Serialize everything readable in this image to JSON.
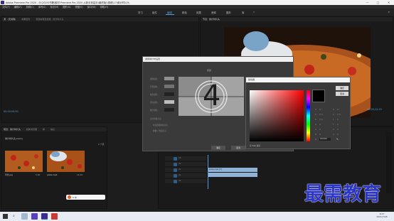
{
  "window": {
    "title": "Adobe Premiere Pro 2020 - D:\\2020\\书籍\\素材 Premiere Pro 2020 从新手到高手(最终版)\\视频\\17\\倒计时片头.",
    "minimize": "—",
    "maximize": "□",
    "close": "✕"
  },
  "menu": [
    "文件(F)",
    "编辑(E)",
    "剪辑(C)",
    "序列(S)",
    "标记(M)",
    "图形(G)",
    "视图(V)",
    "窗口(W)",
    "帮助(H)"
  ],
  "workspaces": {
    "tabs": [
      "学习",
      "组件",
      "编辑",
      "颜色",
      "效果",
      "音频",
      "图形",
      "库"
    ],
    "active_index": 2,
    "more": "»"
  },
  "source_panel": {
    "tabs": [
      "源：(无剪辑)",
      "效果控件",
      "音频剪辑混合器：倒计时片头"
    ],
    "timecode": "00;00;00;00"
  },
  "program_panel": {
    "tabs": [
      "节目：倒计时片头"
    ],
    "timecode_right": "00;00;12;19"
  },
  "project_panel": {
    "tabs": [
      "项目：倒计时片头",
      "媒体浏览器",
      "库",
      "信息"
    ],
    "file": "倒计时片头.prproj",
    "count": "2 个项",
    "items": [
      {
        "name": "背景.jpg",
        "dur": "5;00"
      },
      {
        "name": "pizza.mp4",
        "dur": "12;19"
      }
    ]
  },
  "timeline": {
    "tracks": [
      "V3",
      "V2",
      "V1",
      "A1",
      "A2"
    ],
    "clips": [
      {
        "label": "pizza.mp4 [V]"
      },
      {
        "label": ""
      }
    ]
  },
  "countdown_dialog": {
    "title": "通用倒计时设置",
    "section": "视频",
    "labels": [
      "擦除颜色：",
      "背景颜色：",
      "线条颜色：",
      "目标颜色：",
      "数字颜色："
    ],
    "swatch_colors": [
      "#8f8f8f",
      "#727272",
      "#222222",
      "#bdbdbd",
      "#222222"
    ],
    "options_label": "出点时提示音",
    "options": [
      "在每秒都响提示音",
      "倒数 2 秒提示音"
    ],
    "number": "4",
    "ok": "确定",
    "cancel": "取消"
  },
  "color_picker": {
    "title": "拾色器",
    "ok": "确定",
    "cancel": "取消",
    "web_only": "仅 Web 颜色",
    "fields": [
      {
        "label": "H",
        "value": "0 °"
      },
      {
        "label": "H",
        "value": "0 °"
      },
      {
        "label": "S",
        "value": "0 %"
      },
      {
        "label": "S",
        "value": "0 %"
      },
      {
        "label": "B",
        "value": "0 %"
      },
      {
        "label": "L",
        "value": "0"
      },
      {
        "label": "R",
        "value": "0"
      },
      {
        "label": "Y",
        "value": "0"
      },
      {
        "label": "G",
        "value": "0"
      },
      {
        "label": "U",
        "value": "0"
      },
      {
        "label": "B",
        "value": "0"
      },
      {
        "label": "V",
        "value": "0"
      }
    ],
    "hex": "000000"
  },
  "ime_bar": {
    "label": "S 中"
  },
  "taskbar": {
    "time": "9:27",
    "date": "2021/7/26"
  },
  "watermark": {
    "text": "最需教育"
  }
}
